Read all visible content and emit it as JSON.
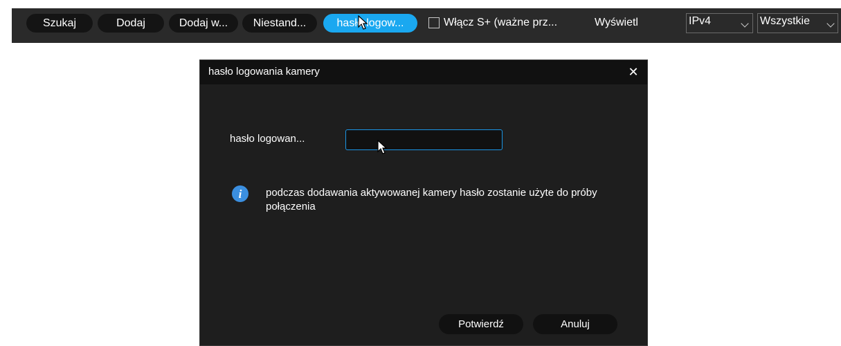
{
  "toolbar": {
    "buttons": [
      {
        "label": "Szukaj"
      },
      {
        "label": "Dodaj"
      },
      {
        "label": "Dodaj w..."
      },
      {
        "label": "Niestand..."
      },
      {
        "label": "hasło logow..."
      }
    ],
    "s_plus_checkbox": {
      "label": "Włącz S+ (ważne prz...",
      "checked": false
    },
    "display_label": "Wyświetl",
    "ip_select": {
      "value": "IPv4"
    },
    "filter_select": {
      "value": "Wszystkie"
    },
    "active_color": "#1aa8f0"
  },
  "dialog": {
    "title": "hasło logowania kamery",
    "close_icon": "close-icon",
    "field_label": "hasło logowan...",
    "password_value": "",
    "info_icon": "info-icon",
    "info_text": "podczas dodawania aktywowanej kamery hasło zostanie użyte do próby połączenia",
    "confirm_label": "Potwierdź",
    "cancel_label": "Anuluj",
    "accent_color": "#1a96e6"
  }
}
